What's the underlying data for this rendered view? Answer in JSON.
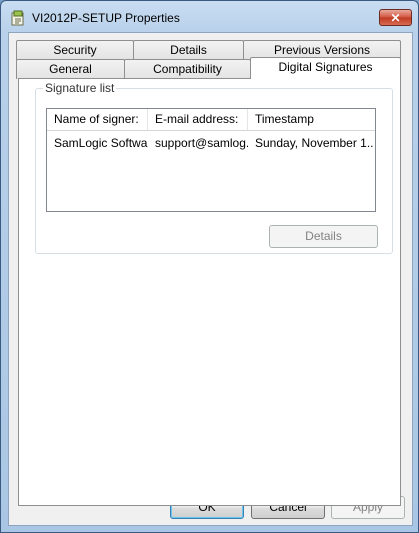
{
  "window": {
    "title": "VI2012P-SETUP Properties",
    "close_glyph": "✕"
  },
  "tabs": {
    "row_back": [
      "Security",
      "Details",
      "Previous Versions"
    ],
    "row_front": [
      "General",
      "Compatibility",
      "Digital Signatures"
    ],
    "active": "Digital Signatures"
  },
  "signature_list": {
    "group_label": "Signature list",
    "columns": [
      "Name of signer:",
      "E-mail address:",
      "Timestamp"
    ],
    "rows": [
      {
        "name": "SamLogic Software",
        "email": "support@samlog...",
        "timestamp": "Sunday, November 1..."
      }
    ],
    "details_button": "Details"
  },
  "footer": {
    "ok": "OK",
    "cancel": "Cancel",
    "apply": "Apply"
  },
  "colors": {
    "titlebar": "#b9d1ea",
    "close_button": "#c9442e",
    "dialog_background": "#f0f0f0",
    "default_button_border": "#3c7fb1"
  }
}
